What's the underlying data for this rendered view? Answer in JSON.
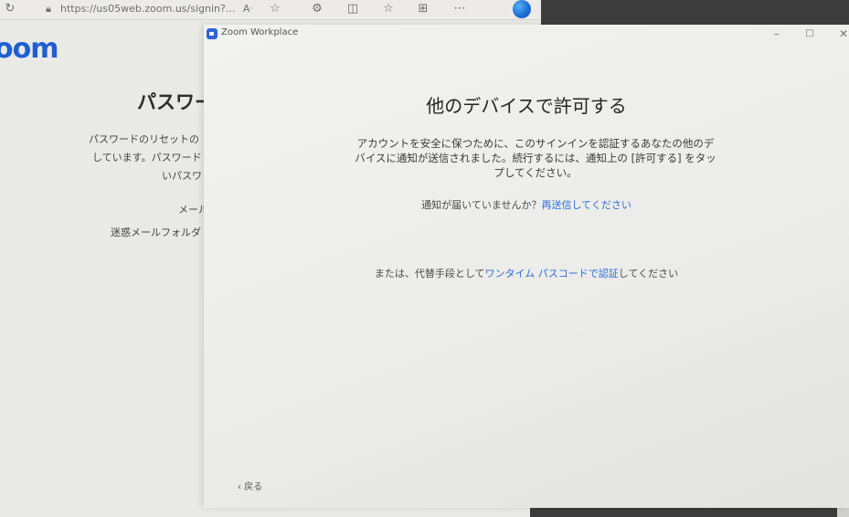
{
  "browser": {
    "url": "https://us05web.zoom.us/signin?...",
    "logo_text": "oom",
    "page": {
      "heading": "パスワー",
      "line1": "パスワードのリセットの",
      "line2": "しています。パスワード",
      "line3": "いパスワ",
      "line4": "メール",
      "line5": "迷惑メールフォルダ"
    }
  },
  "icons": {
    "refresh": "refresh-icon",
    "lock": "lock-icon",
    "read_aloud": "read-aloud-icon",
    "favorite": "star-icon",
    "extensions": "puzzle-icon",
    "split": "split-screen-icon",
    "favorites_bar": "favorites-icon",
    "collections": "collections-icon",
    "more": "more-icon",
    "copilot": "copilot-icon"
  },
  "dialog": {
    "window_title": "Zoom Workplace",
    "heading": "他のデバイスで許可する",
    "description": "アカウントを安全に保つために、このサインインを認証するあなたの他のデバイスに通知が送信されました。続行するには、通知上の [許可する] をタップしてください。",
    "resend_prompt": "通知が届いていませんか？",
    "resend_link": "再送信してください",
    "alt_prefix": "または、代替手段として",
    "alt_link": "ワンタイム パスコードで認証",
    "alt_suffix": "してください",
    "back_label": "‹ 戻る"
  },
  "colors": {
    "link": "#2f6ed9",
    "zoom_blue": "#2d64d8"
  }
}
